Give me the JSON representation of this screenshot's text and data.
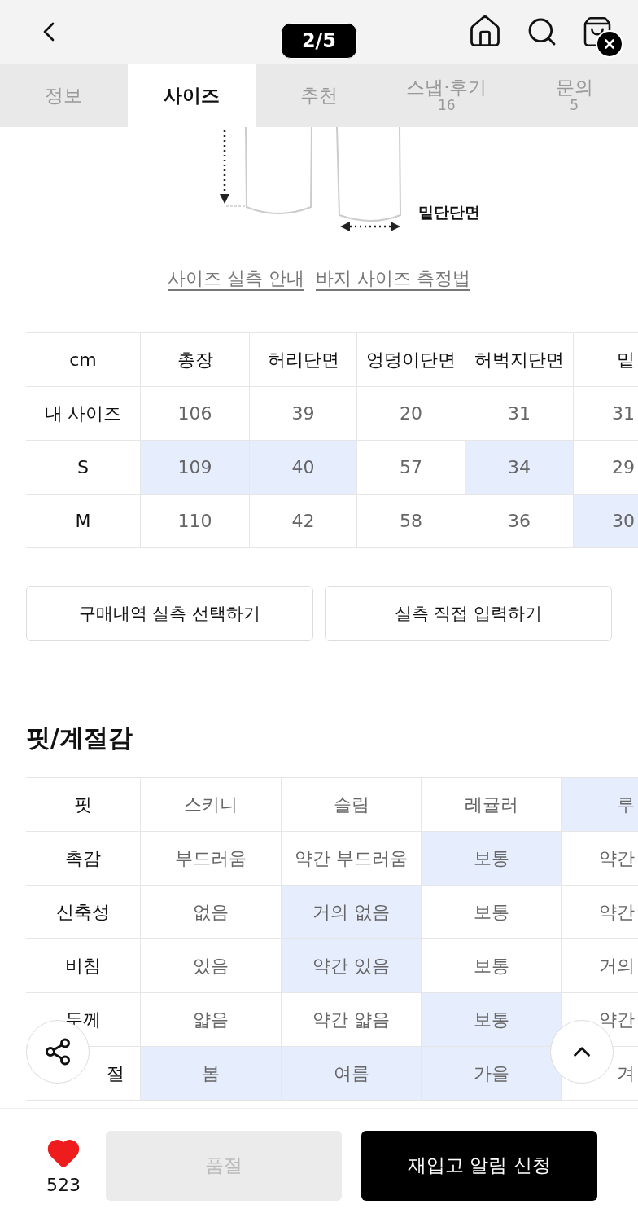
{
  "top_bar": {
    "page_indicator": "2/5"
  },
  "tabs": [
    {
      "label": "정보",
      "selected": false
    },
    {
      "label": "사이즈",
      "selected": true
    },
    {
      "label": "추천",
      "selected": false
    },
    {
      "label": "스냅·후기",
      "count": "16",
      "selected": false
    },
    {
      "label": "문의",
      "count": "5",
      "selected": false
    }
  ],
  "drawing": {
    "label": "밑단단면"
  },
  "links": [
    "사이즈 실측 안내",
    "바지 사이즈 측정법"
  ],
  "size_table": {
    "unit": "cm",
    "columns": [
      "총장",
      "허리단면",
      "엉덩이단면",
      "허벅지단면",
      "밑"
    ],
    "rows": [
      {
        "label": "내 사이즈",
        "cells": [
          {
            "text": "106",
            "highlighted": false
          },
          {
            "text": "39",
            "highlighted": false
          },
          {
            "text": "20",
            "highlighted": false
          },
          {
            "text": "31",
            "highlighted": false
          },
          {
            "text": "31",
            "highlighted": false
          }
        ]
      },
      {
        "label": "S",
        "cells": [
          {
            "text": "109",
            "highlighted": true
          },
          {
            "text": "40",
            "highlighted": true
          },
          {
            "text": "57",
            "highlighted": false
          },
          {
            "text": "34",
            "highlighted": true
          },
          {
            "text": "29",
            "highlighted": false
          }
        ]
      },
      {
        "label": "M",
        "cells": [
          {
            "text": "110",
            "highlighted": false
          },
          {
            "text": "42",
            "highlighted": false
          },
          {
            "text": "58",
            "highlighted": false
          },
          {
            "text": "36",
            "highlighted": false
          },
          {
            "text": "30",
            "highlighted": true
          }
        ]
      }
    ]
  },
  "size_actions": [
    "구매내역 실측 선택하기",
    "실측 직접 입력하기"
  ],
  "fit_section": {
    "title": "핏/계절감",
    "rows": [
      {
        "label": "핏",
        "cells": [
          {
            "text": "스키니",
            "highlighted": false
          },
          {
            "text": "슬림",
            "highlighted": false
          },
          {
            "text": "레귤러",
            "highlighted": false
          },
          {
            "text": "루",
            "highlighted": true
          }
        ]
      },
      {
        "label": "촉감",
        "cells": [
          {
            "text": "부드러움",
            "highlighted": false
          },
          {
            "text": "약간 부드러움",
            "highlighted": false
          },
          {
            "text": "보통",
            "highlighted": true
          },
          {
            "text": "약간",
            "highlighted": false
          }
        ]
      },
      {
        "label": "신축성",
        "cells": [
          {
            "text": "없음",
            "highlighted": false
          },
          {
            "text": "거의 없음",
            "highlighted": true
          },
          {
            "text": "보통",
            "highlighted": false
          },
          {
            "text": "약간",
            "highlighted": false
          }
        ]
      },
      {
        "label": "비침",
        "cells": [
          {
            "text": "있음",
            "highlighted": false
          },
          {
            "text": "약간 있음",
            "highlighted": true
          },
          {
            "text": "보통",
            "highlighted": false
          },
          {
            "text": "거의",
            "highlighted": false
          }
        ]
      },
      {
        "label": "두께",
        "cells": [
          {
            "text": "얇음",
            "highlighted": false
          },
          {
            "text": "약간 얇음",
            "highlighted": false
          },
          {
            "text": "보통",
            "highlighted": true
          },
          {
            "text": "약간",
            "highlighted": false
          }
        ]
      },
      {
        "label": "절",
        "cells": [
          {
            "text": "봄",
            "highlighted": true
          },
          {
            "text": "여름",
            "highlighted": true
          },
          {
            "text": "가을",
            "highlighted": true
          },
          {
            "text": "겨",
            "highlighted": false
          }
        ]
      }
    ]
  },
  "bottom_bar": {
    "likes": "523",
    "sold_out_button": {
      "label": "품절",
      "disabled": true
    },
    "restock_button": "재입고 알림 신청"
  }
}
